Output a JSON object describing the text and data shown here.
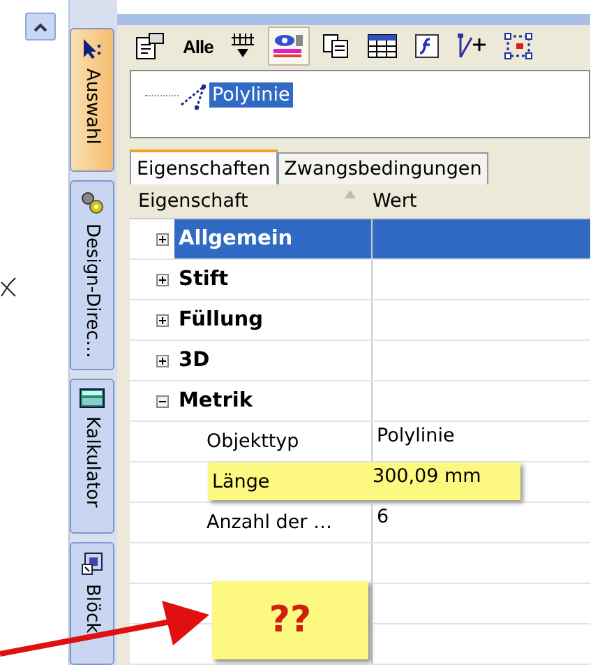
{
  "sidebar_tabs": [
    {
      "label": "Auswahl",
      "selected": true
    },
    {
      "label": "Design-Direc…",
      "selected": false
    },
    {
      "label": "Kalkulator",
      "selected": false
    },
    {
      "label": "Blöck",
      "selected": false
    }
  ],
  "toolbar": {
    "buttons": [
      {
        "kind": "properties",
        "pressed": false
      },
      {
        "kind": "text",
        "label": "Alle",
        "pressed": false
      },
      {
        "kind": "filter",
        "pressed": false
      },
      {
        "kind": "layers",
        "pressed": true
      },
      {
        "kind": "copy",
        "pressed": false
      },
      {
        "kind": "table",
        "pressed": false
      },
      {
        "kind": "function",
        "pressed": false
      },
      {
        "kind": "move",
        "pressed": false
      },
      {
        "kind": "select",
        "pressed": false
      }
    ]
  },
  "tree": {
    "items": [
      {
        "label": "Polylinie",
        "selected": true
      }
    ]
  },
  "tabs": [
    {
      "label": "Eigenschaften",
      "selected": true
    },
    {
      "label": "Zwangsbedingungen",
      "selected": false
    }
  ],
  "grid": {
    "columns": [
      "Eigenschaft",
      "Wert"
    ],
    "groups": [
      {
        "label": "Allgemein",
        "expanded": false,
        "selected": true
      },
      {
        "label": "Stift",
        "expanded": false,
        "selected": false
      },
      {
        "label": "Füllung",
        "expanded": false,
        "selected": false
      },
      {
        "label": "3D",
        "expanded": false,
        "selected": false
      },
      {
        "label": "Metrik",
        "expanded": true,
        "selected": false,
        "children": [
          {
            "label": "Objekttyp",
            "value": "Polylinie",
            "highlighted": false
          },
          {
            "label": "Länge",
            "value": "300,09 mm",
            "highlighted": true
          },
          {
            "label": "Anzahl der …",
            "value": "6",
            "highlighted": false
          }
        ]
      }
    ]
  },
  "note": {
    "text": "??"
  }
}
